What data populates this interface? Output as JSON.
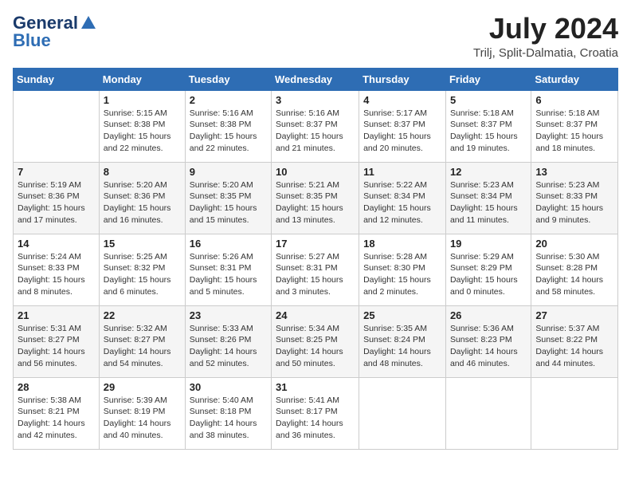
{
  "header": {
    "logo_line1": "General",
    "logo_line2": "Blue",
    "month": "July 2024",
    "location": "Trilj, Split-Dalmatia, Croatia"
  },
  "weekdays": [
    "Sunday",
    "Monday",
    "Tuesday",
    "Wednesday",
    "Thursday",
    "Friday",
    "Saturday"
  ],
  "weeks": [
    [
      {
        "day": "",
        "info": ""
      },
      {
        "day": "1",
        "info": "Sunrise: 5:15 AM\nSunset: 8:38 PM\nDaylight: 15 hours\nand 22 minutes."
      },
      {
        "day": "2",
        "info": "Sunrise: 5:16 AM\nSunset: 8:38 PM\nDaylight: 15 hours\nand 22 minutes."
      },
      {
        "day": "3",
        "info": "Sunrise: 5:16 AM\nSunset: 8:37 PM\nDaylight: 15 hours\nand 21 minutes."
      },
      {
        "day": "4",
        "info": "Sunrise: 5:17 AM\nSunset: 8:37 PM\nDaylight: 15 hours\nand 20 minutes."
      },
      {
        "day": "5",
        "info": "Sunrise: 5:18 AM\nSunset: 8:37 PM\nDaylight: 15 hours\nand 19 minutes."
      },
      {
        "day": "6",
        "info": "Sunrise: 5:18 AM\nSunset: 8:37 PM\nDaylight: 15 hours\nand 18 minutes."
      }
    ],
    [
      {
        "day": "7",
        "info": "Sunrise: 5:19 AM\nSunset: 8:36 PM\nDaylight: 15 hours\nand 17 minutes."
      },
      {
        "day": "8",
        "info": "Sunrise: 5:20 AM\nSunset: 8:36 PM\nDaylight: 15 hours\nand 16 minutes."
      },
      {
        "day": "9",
        "info": "Sunrise: 5:20 AM\nSunset: 8:35 PM\nDaylight: 15 hours\nand 15 minutes."
      },
      {
        "day": "10",
        "info": "Sunrise: 5:21 AM\nSunset: 8:35 PM\nDaylight: 15 hours\nand 13 minutes."
      },
      {
        "day": "11",
        "info": "Sunrise: 5:22 AM\nSunset: 8:34 PM\nDaylight: 15 hours\nand 12 minutes."
      },
      {
        "day": "12",
        "info": "Sunrise: 5:23 AM\nSunset: 8:34 PM\nDaylight: 15 hours\nand 11 minutes."
      },
      {
        "day": "13",
        "info": "Sunrise: 5:23 AM\nSunset: 8:33 PM\nDaylight: 15 hours\nand 9 minutes."
      }
    ],
    [
      {
        "day": "14",
        "info": "Sunrise: 5:24 AM\nSunset: 8:33 PM\nDaylight: 15 hours\nand 8 minutes."
      },
      {
        "day": "15",
        "info": "Sunrise: 5:25 AM\nSunset: 8:32 PM\nDaylight: 15 hours\nand 6 minutes."
      },
      {
        "day": "16",
        "info": "Sunrise: 5:26 AM\nSunset: 8:31 PM\nDaylight: 15 hours\nand 5 minutes."
      },
      {
        "day": "17",
        "info": "Sunrise: 5:27 AM\nSunset: 8:31 PM\nDaylight: 15 hours\nand 3 minutes."
      },
      {
        "day": "18",
        "info": "Sunrise: 5:28 AM\nSunset: 8:30 PM\nDaylight: 15 hours\nand 2 minutes."
      },
      {
        "day": "19",
        "info": "Sunrise: 5:29 AM\nSunset: 8:29 PM\nDaylight: 15 hours\nand 0 minutes."
      },
      {
        "day": "20",
        "info": "Sunrise: 5:30 AM\nSunset: 8:28 PM\nDaylight: 14 hours\nand 58 minutes."
      }
    ],
    [
      {
        "day": "21",
        "info": "Sunrise: 5:31 AM\nSunset: 8:27 PM\nDaylight: 14 hours\nand 56 minutes."
      },
      {
        "day": "22",
        "info": "Sunrise: 5:32 AM\nSunset: 8:27 PM\nDaylight: 14 hours\nand 54 minutes."
      },
      {
        "day": "23",
        "info": "Sunrise: 5:33 AM\nSunset: 8:26 PM\nDaylight: 14 hours\nand 52 minutes."
      },
      {
        "day": "24",
        "info": "Sunrise: 5:34 AM\nSunset: 8:25 PM\nDaylight: 14 hours\nand 50 minutes."
      },
      {
        "day": "25",
        "info": "Sunrise: 5:35 AM\nSunset: 8:24 PM\nDaylight: 14 hours\nand 48 minutes."
      },
      {
        "day": "26",
        "info": "Sunrise: 5:36 AM\nSunset: 8:23 PM\nDaylight: 14 hours\nand 46 minutes."
      },
      {
        "day": "27",
        "info": "Sunrise: 5:37 AM\nSunset: 8:22 PM\nDaylight: 14 hours\nand 44 minutes."
      }
    ],
    [
      {
        "day": "28",
        "info": "Sunrise: 5:38 AM\nSunset: 8:21 PM\nDaylight: 14 hours\nand 42 minutes."
      },
      {
        "day": "29",
        "info": "Sunrise: 5:39 AM\nSunset: 8:19 PM\nDaylight: 14 hours\nand 40 minutes."
      },
      {
        "day": "30",
        "info": "Sunrise: 5:40 AM\nSunset: 8:18 PM\nDaylight: 14 hours\nand 38 minutes."
      },
      {
        "day": "31",
        "info": "Sunrise: 5:41 AM\nSunset: 8:17 PM\nDaylight: 14 hours\nand 36 minutes."
      },
      {
        "day": "",
        "info": ""
      },
      {
        "day": "",
        "info": ""
      },
      {
        "day": "",
        "info": ""
      }
    ]
  ]
}
